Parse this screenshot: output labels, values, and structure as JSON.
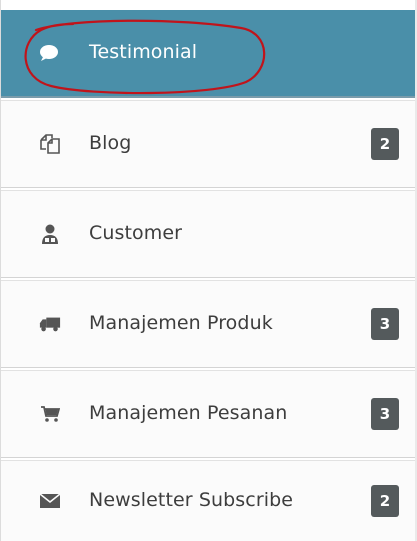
{
  "menu": {
    "items": [
      {
        "label": "Testimonial",
        "icon": "comment-icon",
        "badge": null,
        "active": true
      },
      {
        "label": "Blog",
        "icon": "copy-icon",
        "badge": "2",
        "active": false
      },
      {
        "label": "Customer",
        "icon": "user-icon",
        "badge": null,
        "active": false
      },
      {
        "label": "Manajemen Produk",
        "icon": "truck-icon",
        "badge": "3",
        "active": false
      },
      {
        "label": "Manajemen Pesanan",
        "icon": "cart-icon",
        "badge": "3",
        "active": false
      },
      {
        "label": "Newsletter Subscribe",
        "icon": "envelope-icon",
        "badge": "2",
        "active": false
      }
    ]
  },
  "colors": {
    "active_bg": "#4a8fa9",
    "badge_bg": "#545a5c",
    "annotation": "#c0141b",
    "icon": "#555555"
  }
}
